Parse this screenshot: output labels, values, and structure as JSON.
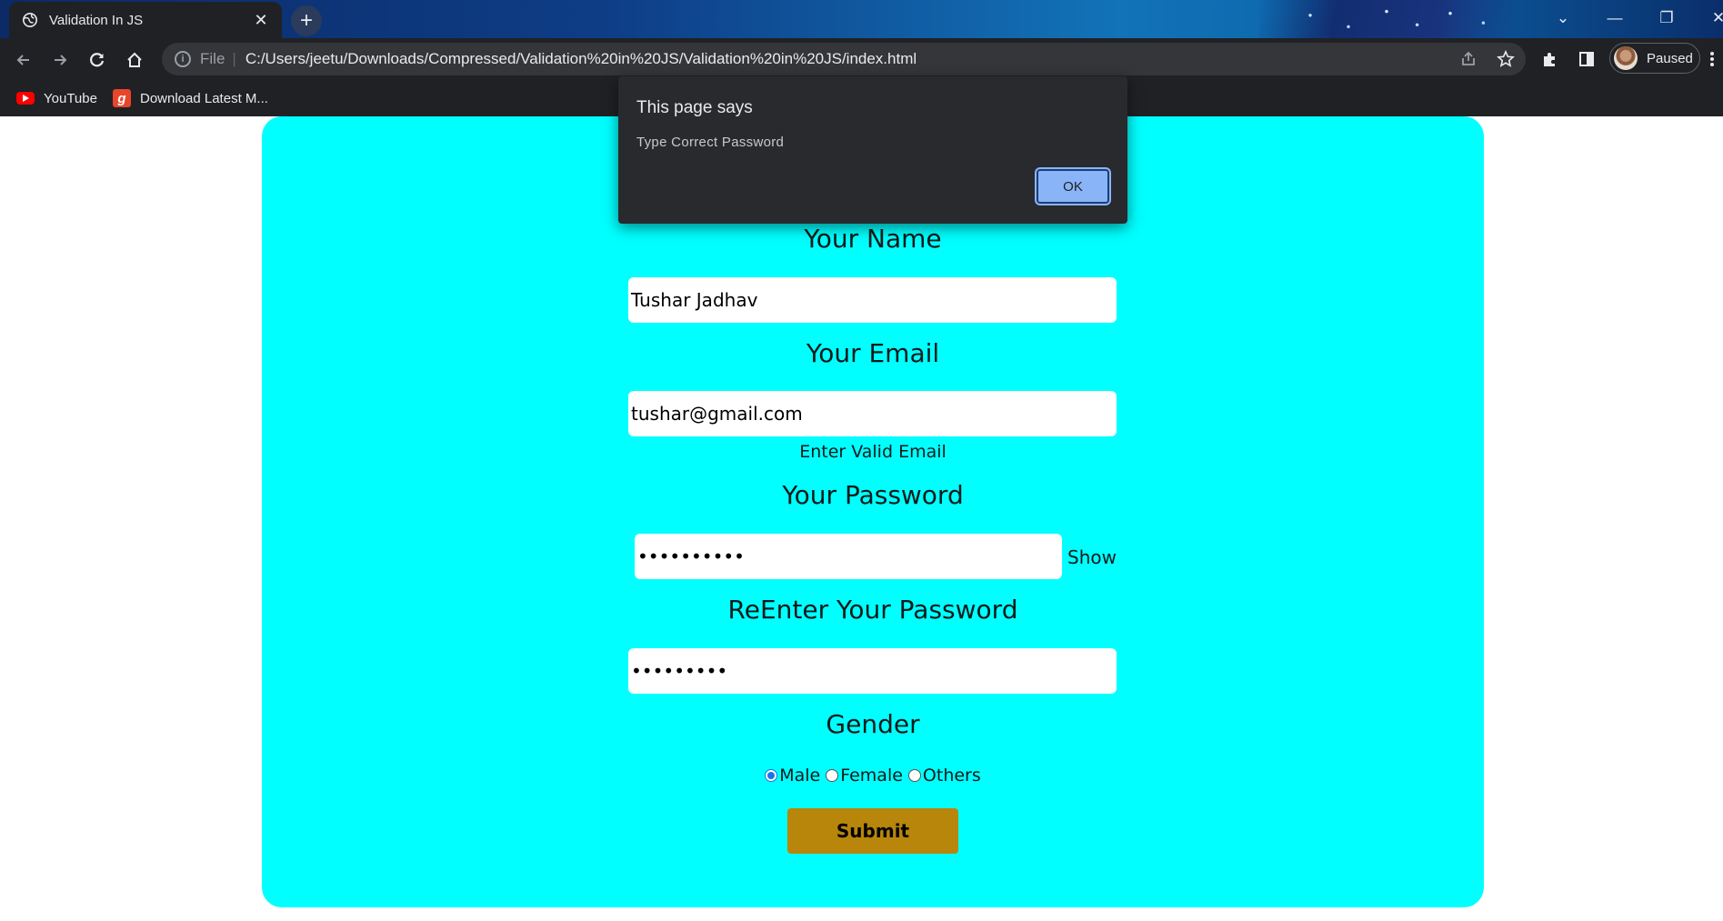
{
  "browser": {
    "tab_title": "Validation In JS",
    "url_scheme": "File",
    "url": "C:/Users/jeetu/Downloads/Compressed/Validation%20in%20JS/Validation%20in%20JS/index.html",
    "profile_label": "Paused",
    "bookmarks": [
      "YouTube",
      "Download Latest M..."
    ]
  },
  "icons": {
    "tab_favicon": "globe-icon",
    "back": "arrow-left-icon",
    "forward": "arrow-right-icon",
    "reload": "reload-icon",
    "home": "home-icon",
    "site_info": "info-icon",
    "share": "share-icon",
    "bookmark_star": "star-icon",
    "extensions": "puzzle-icon",
    "side_panel": "side-panel-icon",
    "menu": "kebab-menu-icon"
  },
  "form": {
    "name_label": "Your Name",
    "name_value": "Tushar Jadhav",
    "email_label": "Your Email",
    "email_value": "tushar@gmail.com",
    "email_hint": "Enter Valid Email",
    "password_label": "Your Password",
    "password_value": "••••••••••",
    "show_label": "Show",
    "repassword_label": "ReEnter Your Password",
    "repassword_value": "•••••••••",
    "gender_label": "Gender",
    "gender_options": [
      "Male",
      "Female",
      "Others"
    ],
    "gender_selected": "Male",
    "submit_label": "Submit"
  },
  "alert": {
    "title": "This page says",
    "message": "Type Correct Password",
    "ok_label": "OK"
  },
  "colors": {
    "card_background": "#00ffff",
    "submit_background": "#b8860b",
    "alert_ok_background": "#8ab4f8",
    "chrome_background": "#202124"
  }
}
